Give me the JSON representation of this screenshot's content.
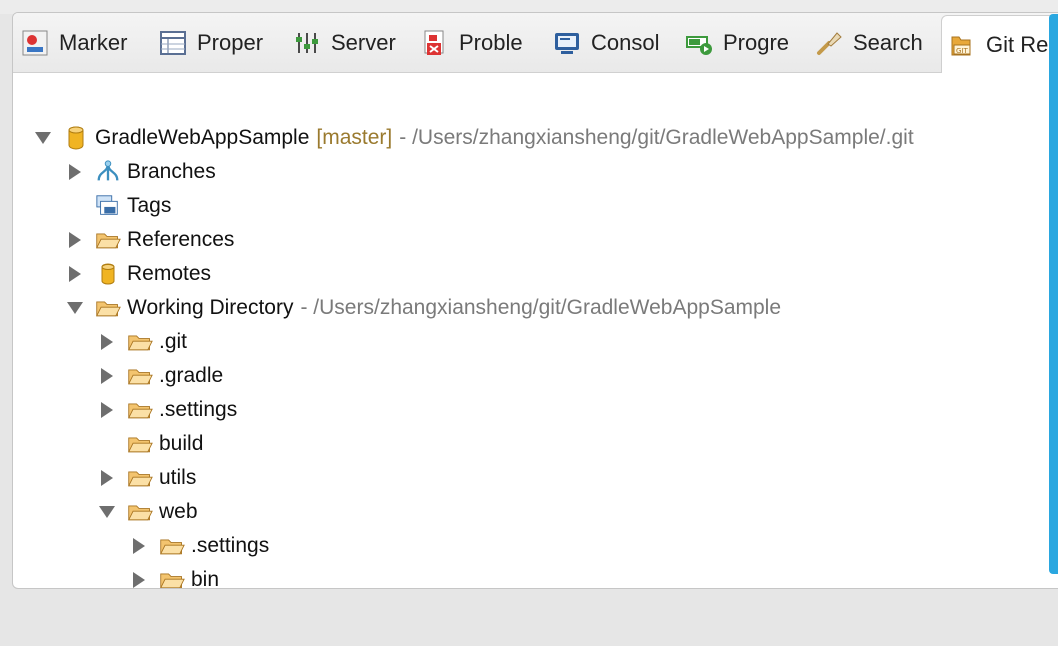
{
  "tabs": [
    {
      "label": "Marker",
      "icon": "markers-icon"
    },
    {
      "label": "Proper",
      "icon": "properties-icon"
    },
    {
      "label": "Server",
      "icon": "servers-icon"
    },
    {
      "label": "Proble",
      "icon": "problems-icon"
    },
    {
      "label": "Consol",
      "icon": "console-icon"
    },
    {
      "label": "Progre",
      "icon": "progress-icon"
    },
    {
      "label": "Search",
      "icon": "search-icon"
    },
    {
      "label": "Git Re",
      "icon": "git-repositories-icon",
      "active": true
    }
  ],
  "tree": {
    "root": {
      "label": "GradleWebAppSample",
      "branch": "[master]",
      "path": "- /Users/zhangxiansheng/git/GradleWebAppSample/.git"
    },
    "branches": "Branches",
    "tags": "Tags",
    "references": "References",
    "remotes": "Remotes",
    "working_directory": {
      "label": "Working Directory",
      "path": "- /Users/zhangxiansheng/git/GradleWebAppSample"
    },
    "git": ".git",
    "gradle": ".gradle",
    "settings": ".settings",
    "build": "build",
    "utils": "utils",
    "web": "web",
    "web_settings": ".settings",
    "web_bin": "bin"
  },
  "colors": {
    "accent": "#2aa7e0",
    "folder": "#e8a83a",
    "branch_text": "#9a7a2e",
    "path_text": "#7a7a7a"
  }
}
